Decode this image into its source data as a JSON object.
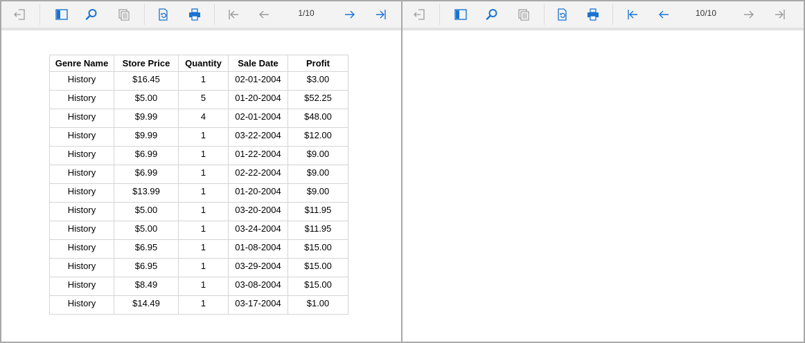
{
  "colors": {
    "accent": "#1a73d1",
    "disabled": "#9a9a9a",
    "toolbar_bg": "#f3f3f3"
  },
  "left_viewer": {
    "toolbar": {
      "page_indicator": "1/10",
      "icons": [
        "exit-icon",
        "sidebar-icon",
        "search-icon",
        "pages-icon",
        "refresh-icon",
        "print-icon",
        "first-page-icon",
        "previous-page-icon",
        "next-page-icon",
        "last-page-icon"
      ]
    },
    "table": {
      "headers": [
        "Genre Name",
        "Store Price",
        "Quantity",
        "Sale Date",
        "Profit"
      ],
      "rows": [
        [
          "History",
          "$16.45",
          "1",
          "02-01-2004",
          "$3.00"
        ],
        [
          "History",
          "$5.00",
          "5",
          "01-20-2004",
          "$52.25"
        ],
        [
          "History",
          "$9.99",
          "4",
          "02-01-2004",
          "$48.00"
        ],
        [
          "History",
          "$9.99",
          "1",
          "03-22-2004",
          "$12.00"
        ],
        [
          "History",
          "$6.99",
          "1",
          "01-22-2004",
          "$9.00"
        ],
        [
          "History",
          "$6.99",
          "1",
          "02-22-2004",
          "$9.00"
        ],
        [
          "History",
          "$13.99",
          "1",
          "01-20-2004",
          "$9.00"
        ],
        [
          "History",
          "$5.00",
          "1",
          "03-20-2004",
          "$11.95"
        ],
        [
          "History",
          "$5.00",
          "1",
          "03-24-2004",
          "$11.95"
        ],
        [
          "History",
          "$6.95",
          "1",
          "01-08-2004",
          "$15.00"
        ],
        [
          "History",
          "$6.95",
          "1",
          "03-29-2004",
          "$15.00"
        ],
        [
          "History",
          "$8.49",
          "1",
          "03-08-2004",
          "$15.00"
        ],
        [
          "History",
          "$14.49",
          "1",
          "03-17-2004",
          "$1.00"
        ]
      ]
    }
  },
  "right_viewer": {
    "toolbar": {
      "page_indicator": "10/10",
      "icons": [
        "exit-icon",
        "sidebar-icon",
        "search-icon",
        "pages-icon",
        "refresh-icon",
        "print-icon",
        "first-page-icon",
        "previous-page-icon",
        "next-page-icon",
        "last-page-icon"
      ]
    }
  }
}
